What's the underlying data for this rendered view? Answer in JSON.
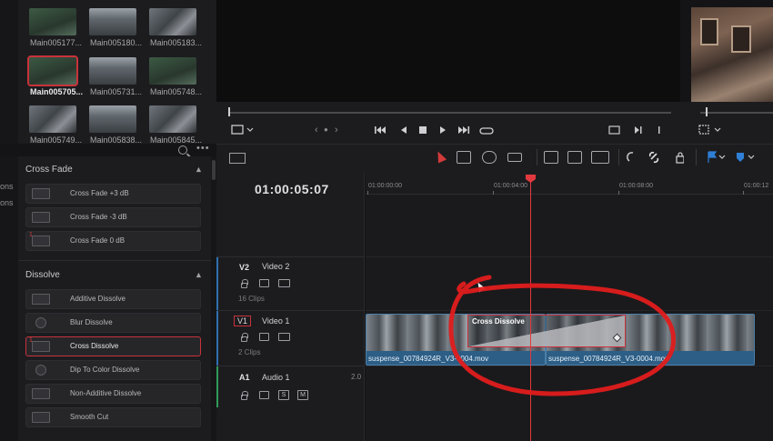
{
  "media_pool": {
    "clips": [
      {
        "label": "Main005177..."
      },
      {
        "label": "Main005180..."
      },
      {
        "label": "Main005183..."
      },
      {
        "label": "Main005705...",
        "selected": true
      },
      {
        "label": "Main005731..."
      },
      {
        "label": "Main005748..."
      },
      {
        "label": "Main005749..."
      },
      {
        "label": "Main005838..."
      },
      {
        "label": "Main005845..."
      }
    ]
  },
  "viewer": {
    "nav_prev": "‹",
    "nav_dot": "●",
    "nav_next": "›"
  },
  "left_sidebar": {
    "text_1": "ons",
    "text_2": "ons"
  },
  "effects": {
    "sections": [
      {
        "title": "Cross Fade",
        "items": [
          {
            "label": "Cross Fade +3 dB"
          },
          {
            "label": "Cross Fade -3 dB"
          },
          {
            "label": "Cross Fade 0 dB",
            "badge": "1"
          }
        ]
      },
      {
        "title": "Dissolve",
        "items": [
          {
            "label": "Additive Dissolve"
          },
          {
            "label": "Blur Dissolve"
          },
          {
            "label": "Cross Dissolve",
            "badge": "1",
            "selected": true
          },
          {
            "label": "Dip To Color Dissolve"
          },
          {
            "label": "Non-Additive Dissolve"
          },
          {
            "label": "Smooth Cut"
          }
        ]
      }
    ]
  },
  "timeline": {
    "timecode": "01:00:05:07",
    "ruler": [
      "01:00:00:00",
      "01:00:04:00",
      "01:00:08:00",
      "01:00:12"
    ],
    "tracks": [
      {
        "id": "V2",
        "name": "Video 2",
        "clips": "16 Clips"
      },
      {
        "id": "V1",
        "name": "Video 1",
        "clips": "2 Clips"
      },
      {
        "id": "A1",
        "name": "Audio 1",
        "level": "2.0",
        "solo": "S",
        "mute": "M"
      }
    ],
    "clips": [
      {
        "name": "suspense_00784924R_V3-0004.mov"
      },
      {
        "name": "suspense_00784924R_V3-0004.mov"
      }
    ],
    "transition_label": "Cross Dissolve"
  },
  "colors": {
    "accent_red": "#c8323a",
    "playhead": "#e2393e",
    "clip_blue": "#2c5e86",
    "annotation": "#e01c1c"
  }
}
